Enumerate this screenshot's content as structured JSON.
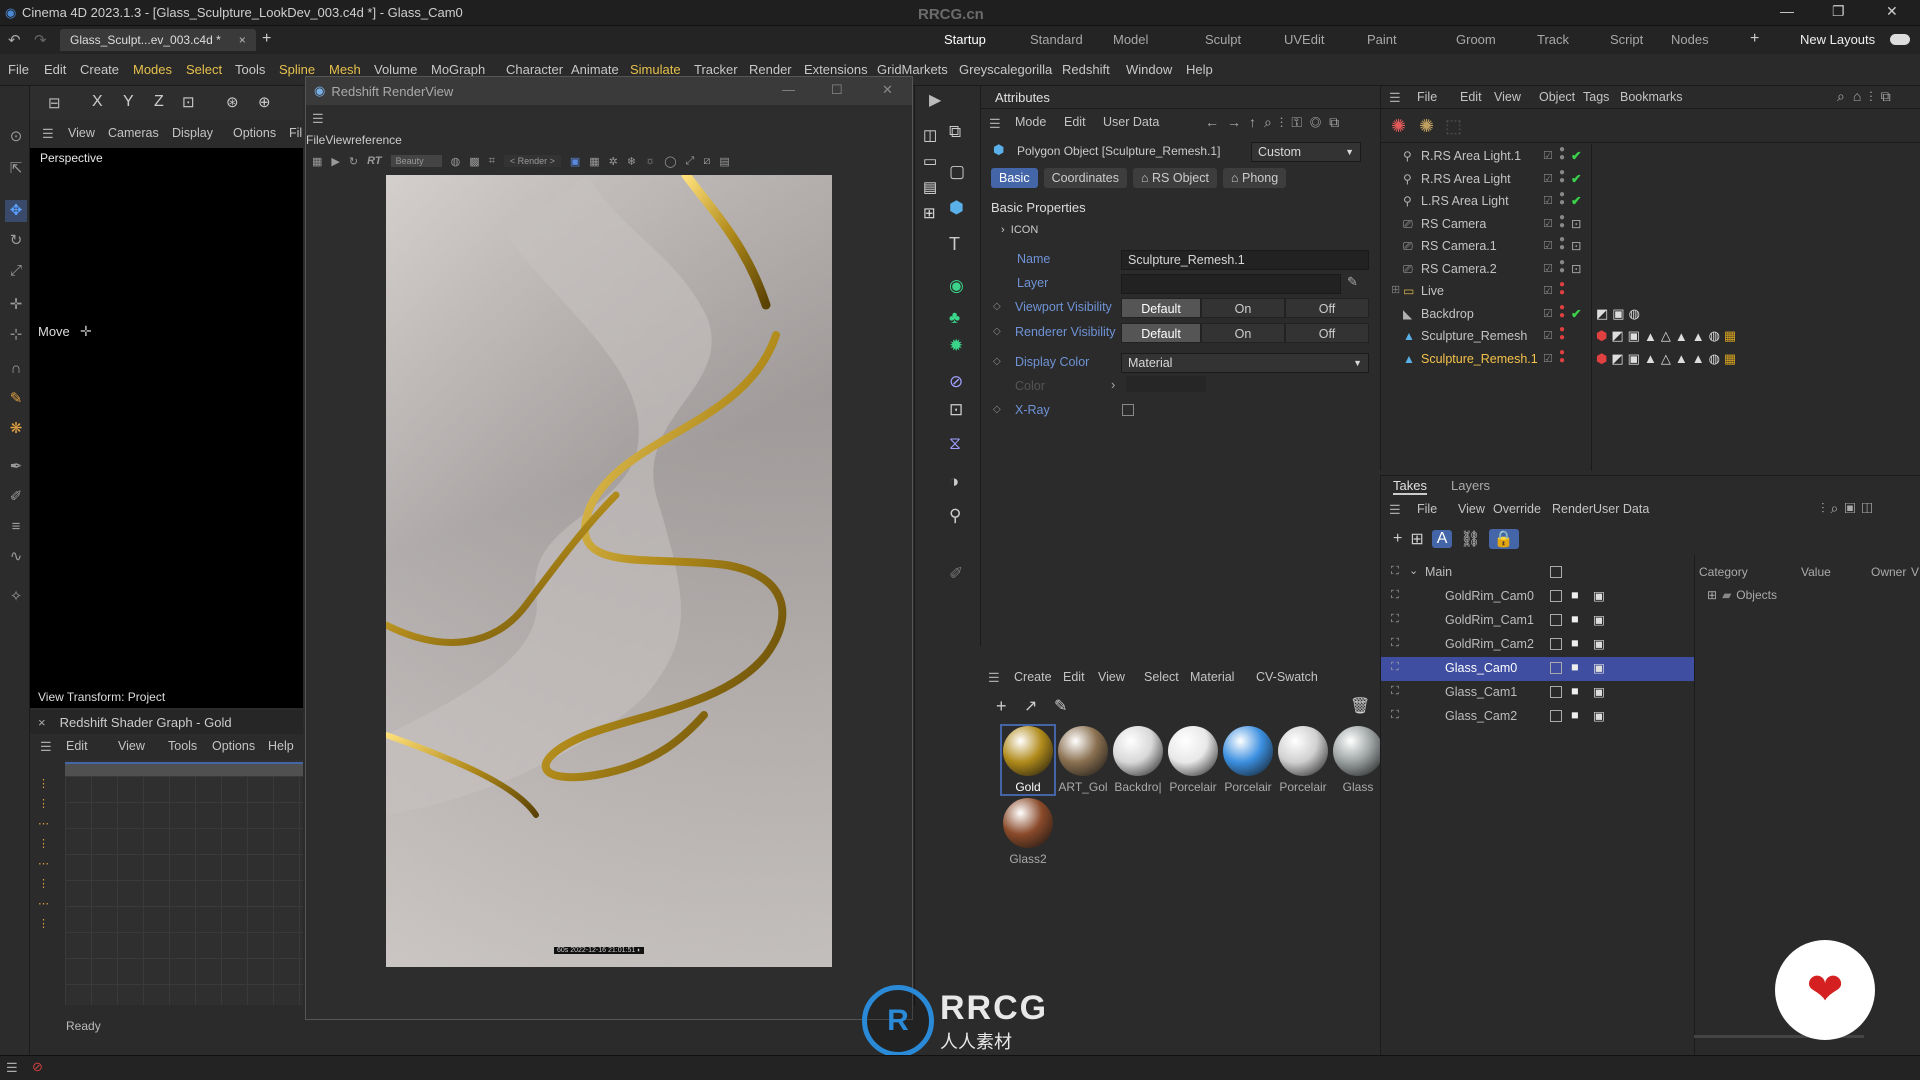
{
  "window": {
    "title": "Cinema 4D 2023.1.3 - [Glass_Sculpture_LookDev_003.c4d *] - Glass_Cam0",
    "watermark": "RRCG.cn"
  },
  "doc_tab": {
    "label": "Glass_Sculpt...ev_003.c4d *",
    "close": "×",
    "add": "+"
  },
  "layouts": {
    "tabs": [
      "Startup",
      "Standard",
      "Model",
      "Sculpt",
      "UVEdit",
      "Paint",
      "Groom",
      "Track",
      "Script",
      "Nodes"
    ],
    "active": "Startup",
    "add": "+",
    "new_layouts": "New Layouts"
  },
  "menubar": [
    {
      "label": "File"
    },
    {
      "label": "Edit"
    },
    {
      "label": "Create"
    },
    {
      "label": "Modes",
      "hl": true
    },
    {
      "label": "Select",
      "hl": true
    },
    {
      "label": "Tools"
    },
    {
      "label": "Spline",
      "hl": true
    },
    {
      "label": "Mesh",
      "hl": true
    },
    {
      "label": "Volume"
    },
    {
      "label": "MoGraph"
    },
    {
      "label": "Character"
    },
    {
      "label": "Animate"
    },
    {
      "label": "Simulate",
      "hl": true
    },
    {
      "label": "Tracker"
    },
    {
      "label": "Render"
    },
    {
      "label": "Extensions"
    },
    {
      "label": "GridMarkets"
    },
    {
      "label": "Greyscalegorilla"
    },
    {
      "label": "Redshift"
    },
    {
      "label": "Window"
    },
    {
      "label": "Help"
    }
  ],
  "viewport": {
    "menu": [
      "View",
      "Cameras",
      "Display",
      "Options",
      "Fil"
    ],
    "name": "Perspective",
    "tool_label": "Move",
    "view_transform": "View Transform: Project"
  },
  "shader_graph": {
    "title": "Redshift Shader Graph - Gold",
    "close": "×",
    "menu": [
      "Edit",
      "View",
      "Tools",
      "Options",
      "Help"
    ]
  },
  "status": {
    "text": "Ready"
  },
  "renderview": {
    "title": "Redshift RenderView",
    "menu": [
      "File",
      "View",
      "reference"
    ],
    "mode": "Beauty",
    "render_label": "< Render >",
    "rt": "RT",
    "stamp": "60s  2022-12-16  21:01:51  ◐"
  },
  "attributes": {
    "title": "Attributes",
    "menu": [
      "Mode",
      "Edit",
      "User Data"
    ],
    "object_label": "Polygon Object [Sculpture_Remesh.1]",
    "preset": "Custom",
    "tabs": [
      {
        "label": "Basic",
        "active": true
      },
      {
        "label": "Coordinates",
        "active": false
      },
      {
        "label": "RS Object",
        "active": false
      },
      {
        "label": "Phong",
        "active": false
      }
    ],
    "section": "Basic Properties",
    "icon_group": "ICON",
    "name_label": "Name",
    "name_value": "Sculpture_Remesh.1",
    "layer_label": "Layer",
    "viewport_vis": {
      "label": "Viewport Visibility",
      "options": [
        "Default",
        "On",
        "Off"
      ],
      "selected": "Default"
    },
    "renderer_vis": {
      "label": "Renderer Visibility",
      "options": [
        "Default",
        "On",
        "Off"
      ],
      "selected": "Default"
    },
    "display_color": {
      "label": "Display Color",
      "value": "Material"
    },
    "color_label": "Color",
    "xray_label": "X-Ray"
  },
  "materials": {
    "menu": [
      "Create",
      "Edit",
      "View",
      "Select",
      "Material",
      "CV-Swatch"
    ],
    "items": [
      {
        "label": "Gold",
        "color": "#b08a1a",
        "selected": true
      },
      {
        "label": "ART_Gol",
        "color": "#8a7050",
        "selected": false
      },
      {
        "label": "Backdro|",
        "color": "#d8d8d8",
        "selected": false
      },
      {
        "label": "Porcelair",
        "color": "#e8e8e8",
        "selected": false
      },
      {
        "label": "Porcelair",
        "color": "#3b8fe0",
        "selected": false
      },
      {
        "label": "Porcelair",
        "color": "#d0d0d0",
        "selected": false
      },
      {
        "label": "Glass",
        "color": "#9aa0a0",
        "selected": false
      },
      {
        "label": "Glass2",
        "color": "#8a4a2a",
        "selected": false
      }
    ]
  },
  "objects": {
    "menu": [
      "File",
      "Edit",
      "View",
      "Object",
      "Tags",
      "Bookmarks"
    ],
    "rows": [
      {
        "name": "R.RS Area Light.1",
        "icon": "light-icon",
        "check": "✔"
      },
      {
        "name": "R.RS Area Light",
        "icon": "light-icon",
        "check": "✔"
      },
      {
        "name": "L.RS Area Light",
        "icon": "light-icon",
        "check": "✔"
      },
      {
        "name": "RS Camera",
        "icon": "camera-icon",
        "check": "⊡"
      },
      {
        "name": "RS Camera.1",
        "icon": "camera-icon",
        "check": "⊡"
      },
      {
        "name": "RS Camera.2",
        "icon": "camera-icon",
        "check": "⊡"
      },
      {
        "name": "Live",
        "icon": "folder-icon",
        "check": ""
      },
      {
        "name": "Backdrop",
        "icon": "backdrop-icon",
        "check": "✔"
      },
      {
        "name": "Sculpture_Remesh",
        "icon": "polygon-icon",
        "check": ""
      },
      {
        "name": "Sculpture_Remesh.1",
        "icon": "polygon-icon",
        "check": "",
        "selected": true
      }
    ]
  },
  "takes": {
    "tabs": [
      "Takes",
      "Layers"
    ],
    "menu": [
      "File",
      "View",
      "Override",
      "Render",
      "User Data"
    ],
    "rows": [
      {
        "name": "Main",
        "main": true
      },
      {
        "name": "GoldRim_Cam0"
      },
      {
        "name": "GoldRim_Cam1"
      },
      {
        "name": "GoldRim_Cam2"
      },
      {
        "name": "Glass_Cam0",
        "selected": true
      },
      {
        "name": "Glass_Cam1"
      },
      {
        "name": "Glass_Cam2"
      }
    ],
    "columns": [
      "Category",
      "Value",
      "Owner",
      "V"
    ],
    "objects_item": "Objects"
  },
  "branding": {
    "logo_text": "RRCG",
    "logo_sub": "人人素材"
  },
  "colors": {
    "accent": "#4466a8",
    "highlight_menu": "#e6c14d",
    "check": "#3bd14a",
    "label": "#6f93d6"
  }
}
